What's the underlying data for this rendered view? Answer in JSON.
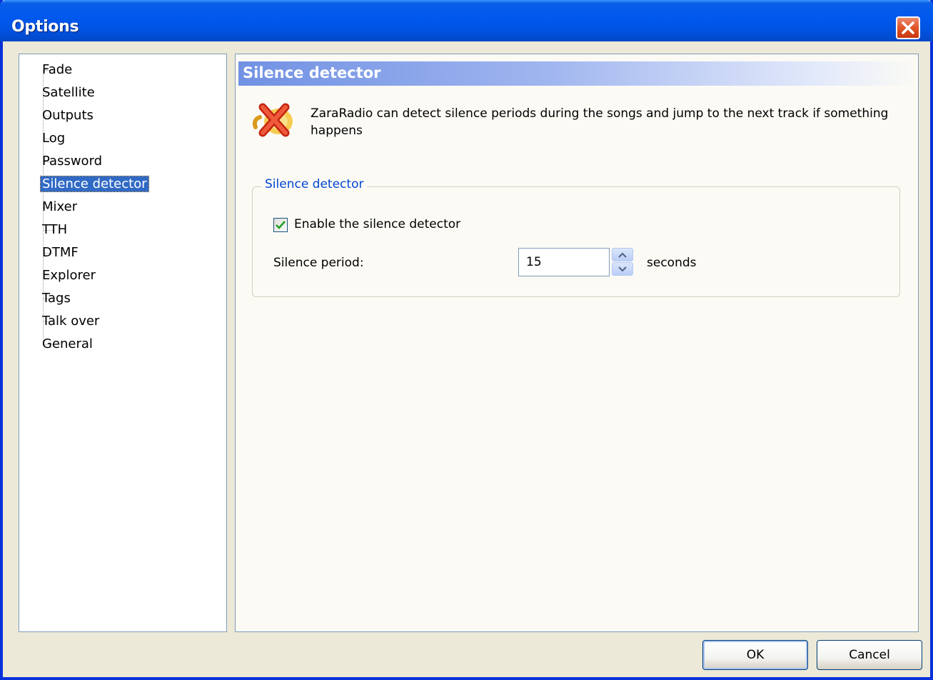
{
  "window": {
    "title": "Options"
  },
  "tree": {
    "items": [
      {
        "label": "Fade"
      },
      {
        "label": "Satellite"
      },
      {
        "label": "Outputs"
      },
      {
        "label": "Log"
      },
      {
        "label": "Password"
      },
      {
        "label": "Silence detector",
        "selected": true
      },
      {
        "label": "Mixer"
      },
      {
        "label": "TTH"
      },
      {
        "label": "DTMF"
      },
      {
        "label": "Explorer"
      },
      {
        "label": "Tags"
      },
      {
        "label": "Talk over"
      },
      {
        "label": "General"
      }
    ]
  },
  "panel": {
    "title": "Silence detector",
    "icon": "red-x-icon",
    "description": "ZaraRadio can detect silence periods during the songs and jump to the next track if something happens",
    "group": {
      "legend": "Silence detector",
      "enable_checkbox": {
        "label": "Enable the silence detector",
        "checked": true
      },
      "period": {
        "label": "Silence period:",
        "value": "15",
        "unit": "seconds"
      }
    }
  },
  "buttons": {
    "ok": "OK",
    "cancel": "Cancel"
  },
  "colors": {
    "titlebar": "#0054e3",
    "selection": "#316ac5",
    "group_legend": "#0046d5",
    "close_button": "#e0542a"
  }
}
